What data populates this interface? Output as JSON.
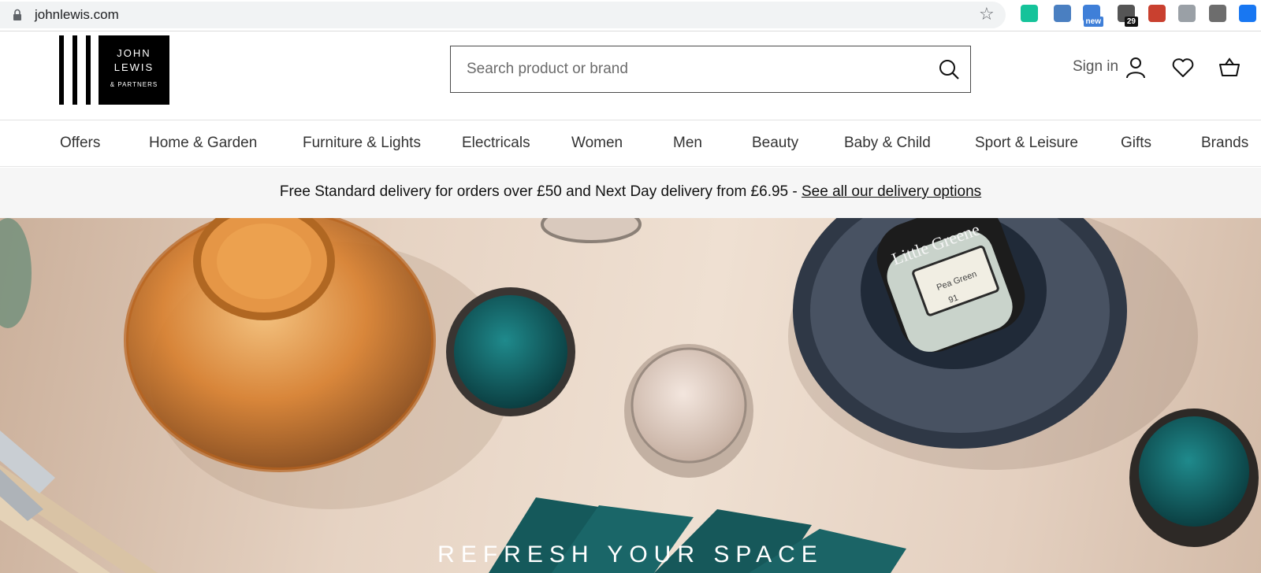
{
  "browser": {
    "url": "johnlewis.com",
    "extensions": [
      {
        "icon": "grammarly-icon",
        "color": "#15c39a",
        "badge": ""
      },
      {
        "icon": "extension-b-icon",
        "color": "#4a7fc1",
        "badge": ""
      },
      {
        "icon": "extension-new-icon",
        "color": "#3f7fd8",
        "badge": "new"
      },
      {
        "icon": "extension-29-icon",
        "color": "#555555",
        "badge": "29"
      },
      {
        "icon": "pdf-icon",
        "color": "#c9402f",
        "badge": ""
      },
      {
        "icon": "extension-x-icon",
        "color": "#9aa0a6",
        "badge": ""
      },
      {
        "icon": "extension-tb-icon",
        "color": "#6d6d6d",
        "badge": ""
      },
      {
        "icon": "facebook-icon",
        "color": "#1877f2",
        "badge": ""
      }
    ]
  },
  "logo": {
    "line1": "JOHN",
    "line2": "LEWIS",
    "line3": "& PARTNERS"
  },
  "search": {
    "placeholder": "Search product or brand"
  },
  "account": {
    "sign_in_label": "Sign in"
  },
  "nav": {
    "items": [
      {
        "label": "Offers"
      },
      {
        "label": "Home & Garden"
      },
      {
        "label": "Furniture & Lights"
      },
      {
        "label": "Electricals"
      },
      {
        "label": "Women"
      },
      {
        "label": "Men"
      },
      {
        "label": "Beauty"
      },
      {
        "label": "Baby & Child"
      },
      {
        "label": "Sport & Leisure"
      },
      {
        "label": "Gifts"
      },
      {
        "label": "Brands"
      }
    ]
  },
  "delivery": {
    "text": "Free Standard delivery for orders over £50 and Next Day delivery from £6.95 - ",
    "link_label": "See all our delivery options"
  },
  "hero": {
    "title": "REFRESH YOUR SPACE",
    "paint_label_brand": "Little Greene",
    "paint_label_colour": "Pea Green",
    "paint_label_number": "91"
  },
  "colors": {
    "accent_teal": "#0f5a5c",
    "brand_black": "#000000"
  }
}
